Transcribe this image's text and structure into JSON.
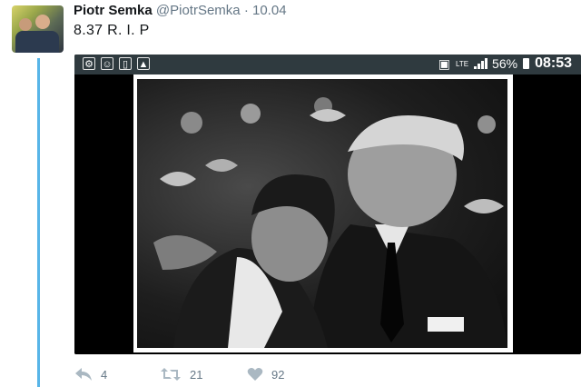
{
  "tweet": {
    "author_name": "Piotr Semka",
    "handle": "@PiotrSemka",
    "separator": "·",
    "timestamp": "10.04",
    "text": "8.37 R. I. P"
  },
  "phone_status": {
    "battery_percent": "56%",
    "time": "08:53",
    "network": "LTE"
  },
  "actions": {
    "reply_count": "4",
    "retweet_count": "21",
    "like_count": "92"
  },
  "colors": {
    "thread_line": "#58b5e8",
    "icon_gray": "#aab8c2",
    "statusbar_bg": "#2f3a3f"
  },
  "icons": [
    "reply-icon",
    "retweet-icon",
    "like-icon"
  ]
}
